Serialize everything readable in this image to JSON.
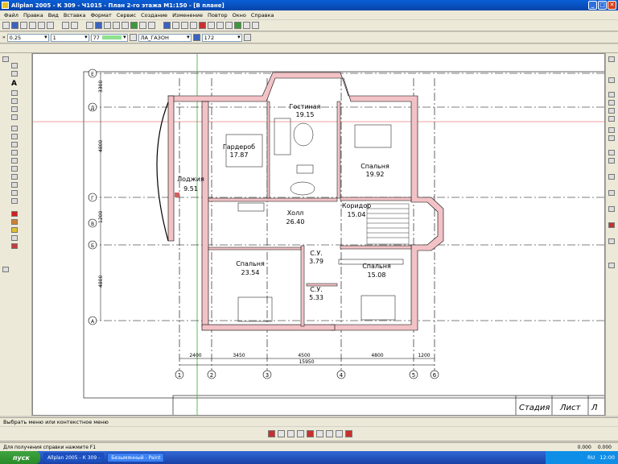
{
  "window": {
    "title": "Allplan 2005 - К 309 - Ч1015 - План 2-го этажа М1:150 - [В плане]"
  },
  "menu": [
    "Файл",
    "Правка",
    "Вид",
    "Вставка",
    "Формат",
    "Сервис",
    "Создание",
    "Изменение",
    "Повтор",
    "Окно",
    "Справка"
  ],
  "properties": {
    "pen": "0.25",
    "line": "1",
    "color": "77",
    "layer": "ЛА_ГАЗОН",
    "scale": "172"
  },
  "plan": {
    "rooms": [
      {
        "name": "Гардероб",
        "area": "17.87"
      },
      {
        "name": "Гостиная",
        "area": "19.15"
      },
      {
        "name": "Спальня",
        "area": "19.92"
      },
      {
        "name": "Лоджия",
        "area": "9.51"
      },
      {
        "name": "Холл",
        "area": "26.40"
      },
      {
        "name": "Коридор",
        "area": "15.04"
      },
      {
        "name": "Спальня",
        "area": "23.54"
      },
      {
        "name": "С.У.",
        "area": "3.79"
      },
      {
        "name": "С.У.",
        "area": "5.33"
      },
      {
        "name": "Спальня",
        "area": "15.08"
      }
    ],
    "axes_bottom": [
      "1",
      "2",
      "3",
      "4",
      "5",
      "6"
    ],
    "axes_left": [
      "Е",
      "Д",
      "Г",
      "В",
      "Б",
      "А"
    ],
    "dims_bottom": [
      "2400",
      "3450",
      "4500",
      "4800",
      "1200"
    ],
    "dim_total": "15950",
    "dims_left": [
      "3300",
      "4800",
      "1200",
      "4800"
    ],
    "stamp": [
      "Стадия",
      "Лист",
      "Л"
    ]
  },
  "status": {
    "message": "Выбрать меню или контекстное меню",
    "help": "Для получения справки нажмите F1",
    "zoom": "0.000",
    "angle": "0.000"
  },
  "taskbar": {
    "start": "пуск",
    "tasks": [
      "Allplan 2005 - К 309 -",
      "Безымянный - Paint"
    ],
    "lang": "RU",
    "clock": "12:00"
  }
}
